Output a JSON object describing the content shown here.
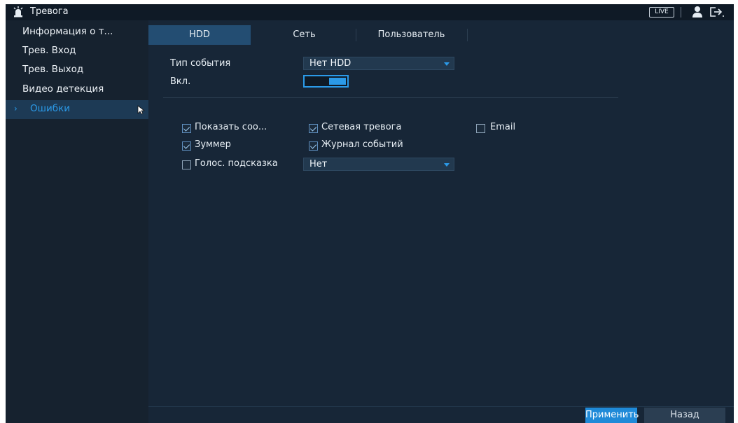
{
  "app": {
    "title": "Тревога",
    "live_label": "LIVE"
  },
  "sidebar": {
    "items": [
      {
        "label": "Информация о т..."
      },
      {
        "label": "Трев. Вход"
      },
      {
        "label": "Трев. Выход"
      },
      {
        "label": "Видео детекция"
      },
      {
        "label": "Ошибки",
        "active": true
      }
    ]
  },
  "tabs": [
    {
      "label": "HDD",
      "active": true
    },
    {
      "label": "Сеть"
    },
    {
      "label": "Пользователь"
    }
  ],
  "form": {
    "event_type_label": "Тип события",
    "event_type_value": "Нет HDD",
    "enable_label": "Вкл.",
    "enable_on": true,
    "checkboxes": [
      {
        "label": "Показать соо...",
        "checked": true
      },
      {
        "label": "Сетевая тревога",
        "checked": true
      },
      {
        "label": "Email",
        "checked": false
      },
      {
        "label": "Зуммер",
        "checked": true
      },
      {
        "label": "Журнал событий",
        "checked": true
      },
      {
        "label": "Голос. подсказка",
        "checked": false
      }
    ],
    "voice_prompt_value": "Нет"
  },
  "buttons": {
    "apply": "Применить",
    "back": "Назад"
  },
  "colors": {
    "accent": "#2b9ae8",
    "background": "#172637",
    "sidebar": "#16222f",
    "tab_active": "#234d72"
  }
}
